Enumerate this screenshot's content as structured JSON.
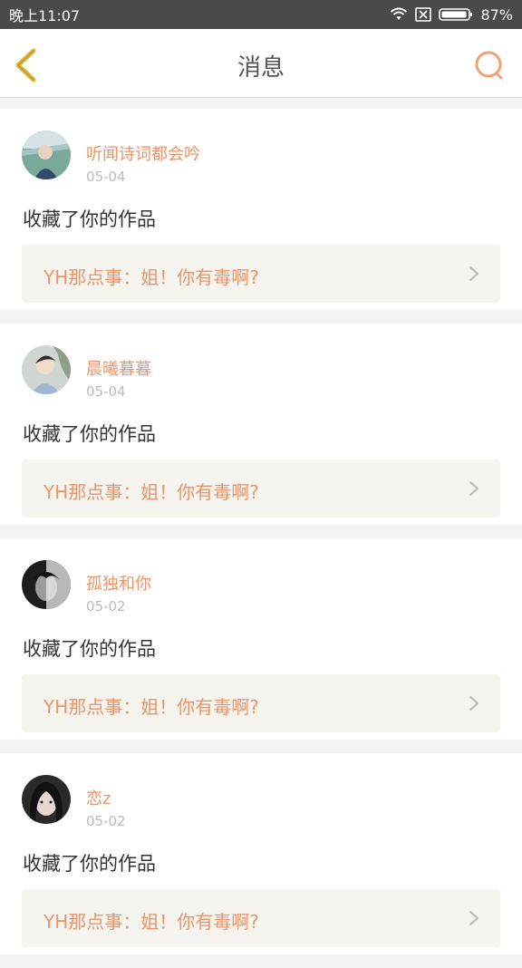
{
  "status_bar": {
    "time": "晚上11:07",
    "battery": "87%"
  },
  "header": {
    "title": "消息"
  },
  "colors": {
    "accent": "#e8956a",
    "back_arrow": "#e2b73a"
  },
  "messages": [
    {
      "user": "听闻诗词都会吟",
      "date": "05-04",
      "action": "收藏了你的作品",
      "work": "YH那点事：姐！你有毒啊?"
    },
    {
      "user": "晨曦暮暮",
      "date": "05-04",
      "action": "收藏了你的作品",
      "work": "YH那点事：姐！你有毒啊?"
    },
    {
      "user": "孤独和你",
      "date": "05-02",
      "action": "收藏了你的作品",
      "work": "YH那点事：姐！你有毒啊?"
    },
    {
      "user": "恋z",
      "date": "05-02",
      "action": "收藏了你的作品",
      "work": "YH那点事：姐！你有毒啊?"
    }
  ]
}
